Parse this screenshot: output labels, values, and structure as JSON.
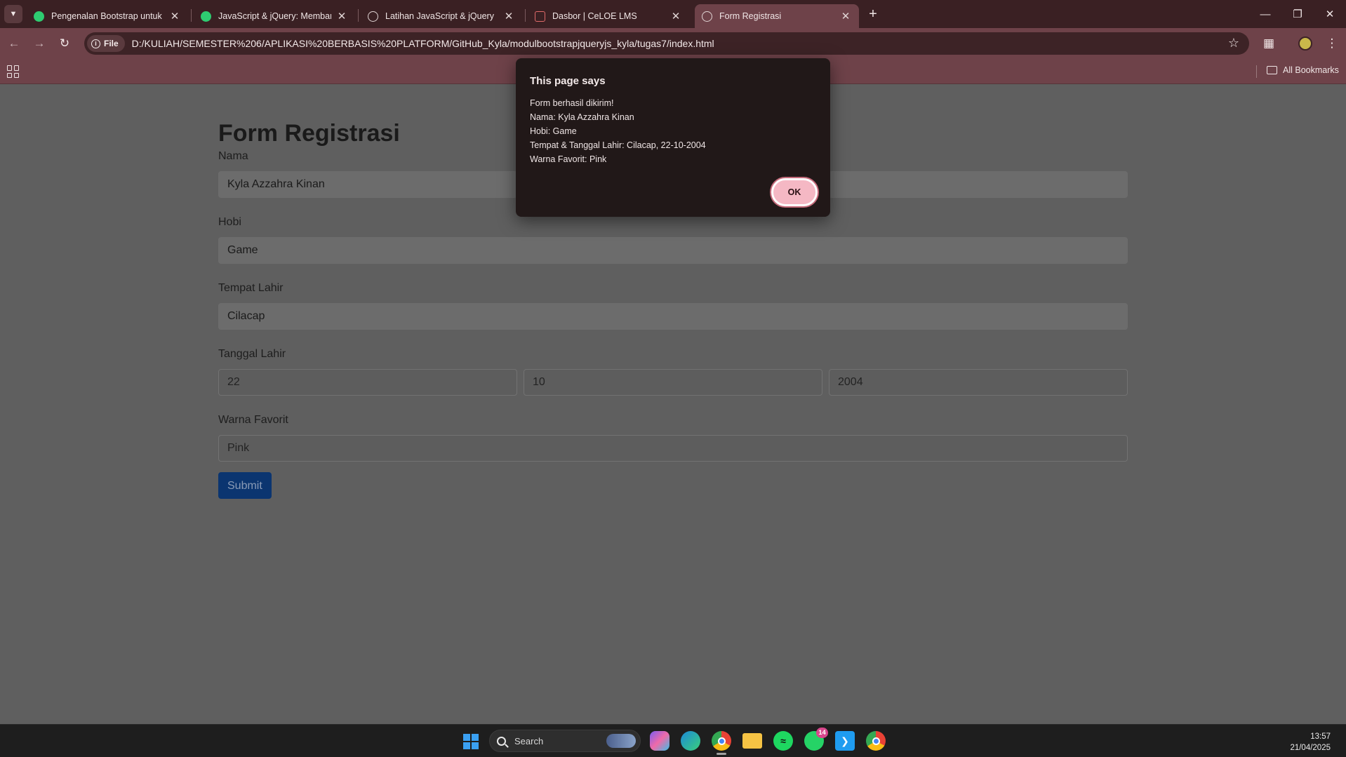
{
  "browser": {
    "tabs": [
      {
        "title": "Pengenalan Bootstrap untuk W",
        "favicon": "bootstrap-green-icon",
        "active": false
      },
      {
        "title": "JavaScript & jQuery: Membang",
        "favicon": "bootstrap-green-icon",
        "active": false
      },
      {
        "title": "Latihan JavaScript & jQuery",
        "favicon": "globe-icon",
        "active": false
      },
      {
        "title": "Dasbor | CeLOE LMS",
        "favicon": "celoe-icon",
        "active": false
      },
      {
        "title": "Form Registrasi",
        "favicon": "globe-icon",
        "active": true
      }
    ],
    "new_tab_label": "+",
    "address_chip": "File",
    "url": "D:/KULIAH/SEMESTER%206/APLIKASI%20BERBASIS%20PLATFORM/GitHub_Kyla/modulbootstrapjqueryjs_kyla/tugas7/index.html",
    "bookmarks_label": "All Bookmarks"
  },
  "form": {
    "heading": "Form Registrasi",
    "fields": {
      "nama": {
        "label": "Nama",
        "value": "Kyla Azzahra Kinan"
      },
      "hobi": {
        "label": "Hobi",
        "value": "Game"
      },
      "tempat": {
        "label": "Tempat Lahir",
        "value": "Cilacap"
      },
      "tanggal": {
        "label": "Tanggal Lahir",
        "day": "22",
        "month": "10",
        "year": "2004"
      },
      "warna": {
        "label": "Warna Favorit",
        "value": "Pink"
      }
    },
    "submit_label": "Submit"
  },
  "alert": {
    "title": "This page says",
    "lines": [
      "Form berhasil dikirim!",
      "Nama: Kyla Azzahra Kinan",
      "Hobi: Game",
      "Tempat & Tanggal Lahir: Cilacap, 22-10-2004",
      "Warna Favorit: Pink"
    ],
    "ok_label": "OK"
  },
  "taskbar": {
    "search_placeholder": "Search",
    "whatsapp_badge": "14",
    "time": "13:57",
    "date": "21/04/2025"
  },
  "colors": {
    "tabbar": "#3a2023",
    "toolbar": "#6e4249",
    "dialog_bg": "#211818",
    "ok_button": "#f5b8c4",
    "submit_button": "#0b3570",
    "page_overlay": "#5f5f5f"
  }
}
